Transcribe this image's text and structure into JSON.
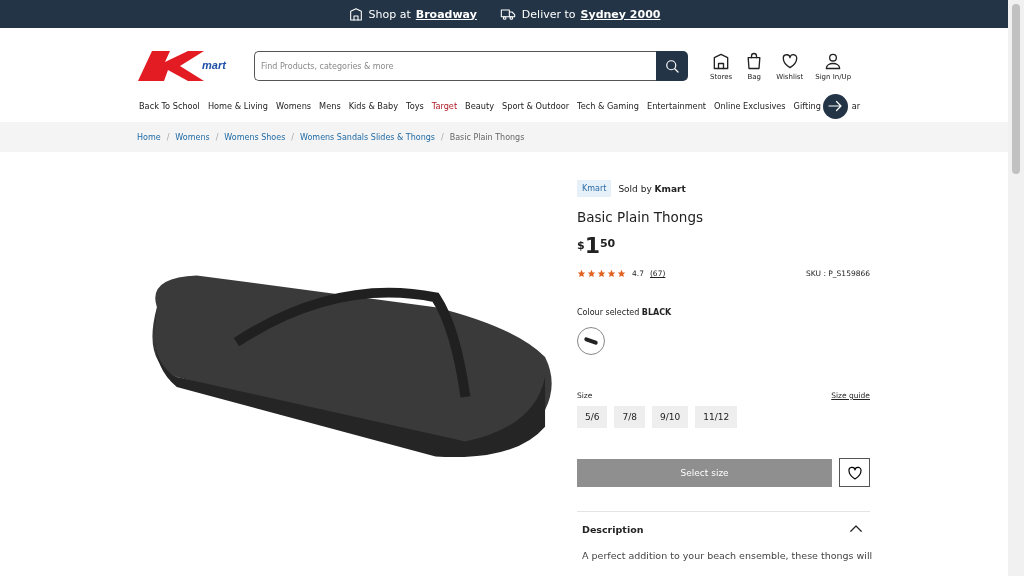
{
  "top_bar": {
    "shop": {
      "prefix": "Shop at",
      "store": "Broadway"
    },
    "deliver": {
      "prefix": "Deliver to",
      "place": "Sydney 2000"
    }
  },
  "header": {
    "logo_text": "mart",
    "search": {
      "placeholder": "Find Products, categories & more"
    },
    "actions": [
      {
        "kind": "stores",
        "label": "Stores"
      },
      {
        "kind": "bag",
        "label": "Bag"
      },
      {
        "kind": "wishlist",
        "label": "Wishlist"
      },
      {
        "kind": "account",
        "label": "Sign In/Up"
      }
    ]
  },
  "nav": [
    {
      "label": "Back To School",
      "highlight": false
    },
    {
      "label": "Home & Living",
      "highlight": false
    },
    {
      "label": "Womens",
      "highlight": false
    },
    {
      "label": "Mens",
      "highlight": false
    },
    {
      "label": "Kids & Baby",
      "highlight": false
    },
    {
      "label": "Toys",
      "highlight": false
    },
    {
      "label": "Target",
      "highlight": true
    },
    {
      "label": "Beauty",
      "highlight": false
    },
    {
      "label": "Sport & Outdoor",
      "highlight": false
    },
    {
      "label": "Tech & Gaming",
      "highlight": false
    },
    {
      "label": "Entertainment",
      "highlight": false
    },
    {
      "label": "Online Exclusives",
      "highlight": false
    },
    {
      "label": "Gifting",
      "highlight": false
    },
    {
      "label": "ar",
      "highlight": false
    }
  ],
  "breadcrumb_separator": "/",
  "breadcrumb": [
    {
      "label": "Home",
      "current": false
    },
    {
      "label": "Womens",
      "current": false
    },
    {
      "label": "Womens Shoes",
      "current": false
    },
    {
      "label": "Womens Sandals Slides & Thongs",
      "current": false
    },
    {
      "label": "Basic Plain Thongs",
      "current": true
    }
  ],
  "product": {
    "brand_tag": "Kmart",
    "sold_by": {
      "prefix": "Sold by",
      "seller": "Kmart"
    },
    "title": "Basic Plain Thongs",
    "price": {
      "currency": "$",
      "dollars": "1",
      "cents": "50"
    },
    "rating": {
      "stars": 5,
      "score": "4.7",
      "count": "(67)"
    },
    "sku": "SKU : P_S159866",
    "colour": {
      "label": "Colour selected",
      "value": "BLACK",
      "swatches": [
        {
          "selected": true
        }
      ]
    },
    "size": {
      "label": "Size",
      "guide": "Size guide",
      "options": [
        {
          "label": "5/6",
          "selected": false
        },
        {
          "label": "7/8",
          "selected": false
        },
        {
          "label": "9/10",
          "selected": false
        },
        {
          "label": "11/12",
          "selected": false
        }
      ]
    },
    "add_button": {
      "label": "Select size",
      "disabled": true
    },
    "description": {
      "title": "Description",
      "expanded": true,
      "text": "A perfect addition to your beach ensemble, these thongs will"
    }
  }
}
